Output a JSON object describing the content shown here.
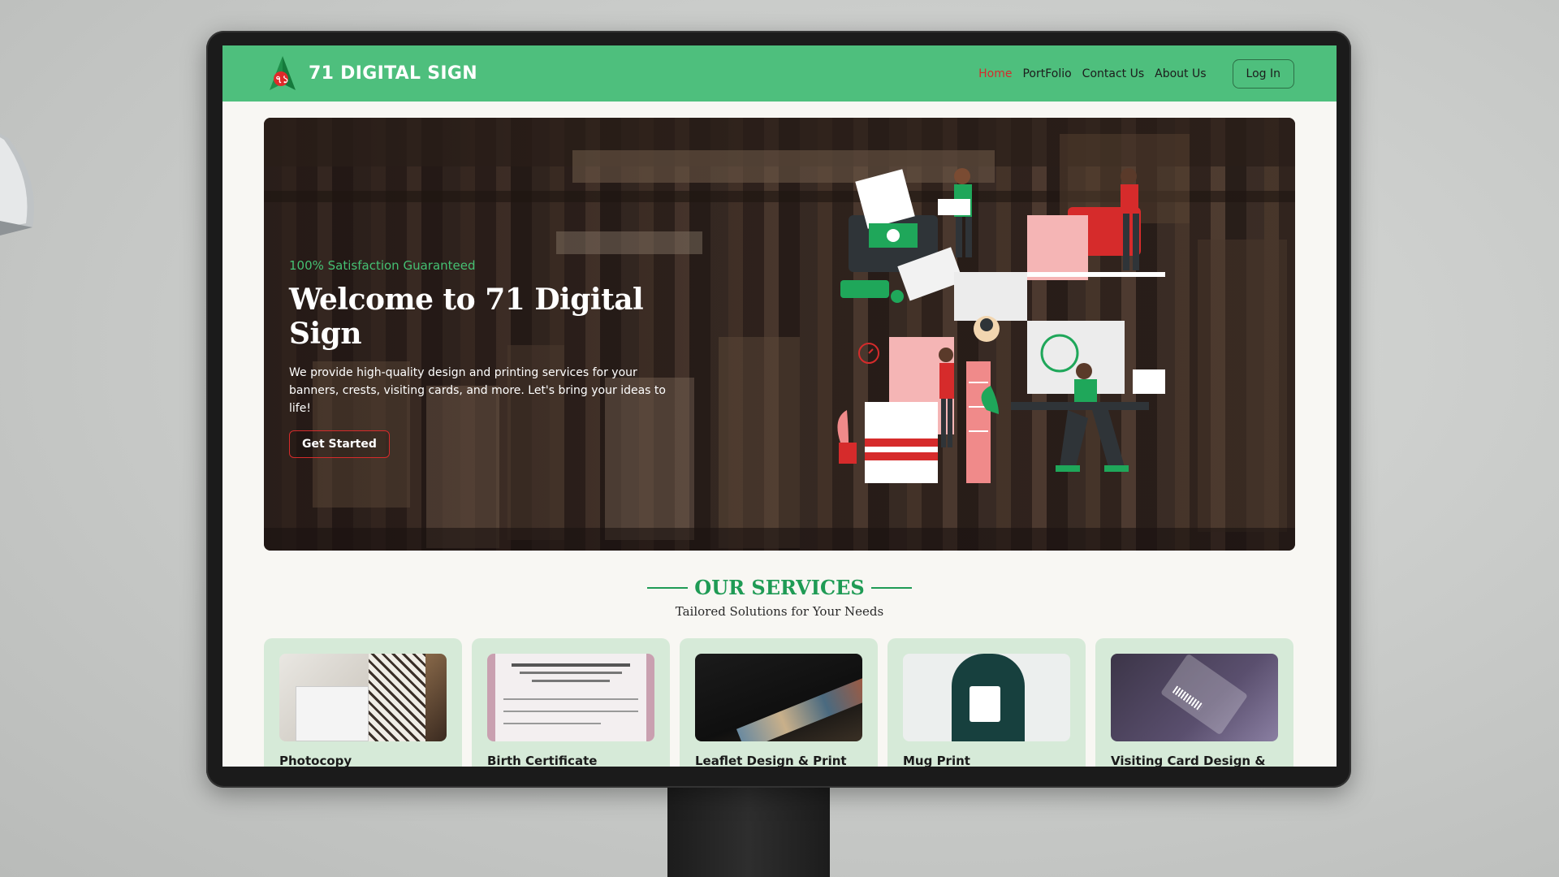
{
  "brand": {
    "name": "71 DIGITAL SIGN",
    "logo_icon": "flag-71-logo-icon"
  },
  "nav": {
    "links": [
      {
        "label": "Home",
        "active": true
      },
      {
        "label": "PortFolio",
        "active": false
      },
      {
        "label": "Contact Us",
        "active": false
      },
      {
        "label": "About Us",
        "active": false
      }
    ],
    "login_label": "Log In"
  },
  "hero": {
    "tagline": "100% Satisfaction Guaranteed",
    "title": "Welcome to 71 Digital Sign",
    "description": "We provide high-quality design and printing services for your banners, crests, visiting cards, and more. Let's bring your ideas to life!",
    "cta_label": "Get Started",
    "illustration_icon": "printing-office-illustration"
  },
  "services": {
    "title": "OUR SERVICES",
    "subtitle": "Tailored Solutions for Your Needs",
    "cards": [
      {
        "title": "Photocopy",
        "image": "photocopier-photo"
      },
      {
        "title": "Birth Certificate",
        "image": "birth-certificate-photo"
      },
      {
        "title": "Leaflet Design & Print",
        "image": "leaflets-photo"
      },
      {
        "title": "Mug Print",
        "image": "mug-photo"
      },
      {
        "title": "Visiting Card Design &",
        "image": "visiting-card-photo"
      }
    ]
  },
  "colors": {
    "nav_bg": "#4ebf7d",
    "accent_red": "#d62b2b",
    "accent_green": "#1f9b55",
    "card_bg": "#d6ead8",
    "page_bg": "#f8f7f3"
  }
}
